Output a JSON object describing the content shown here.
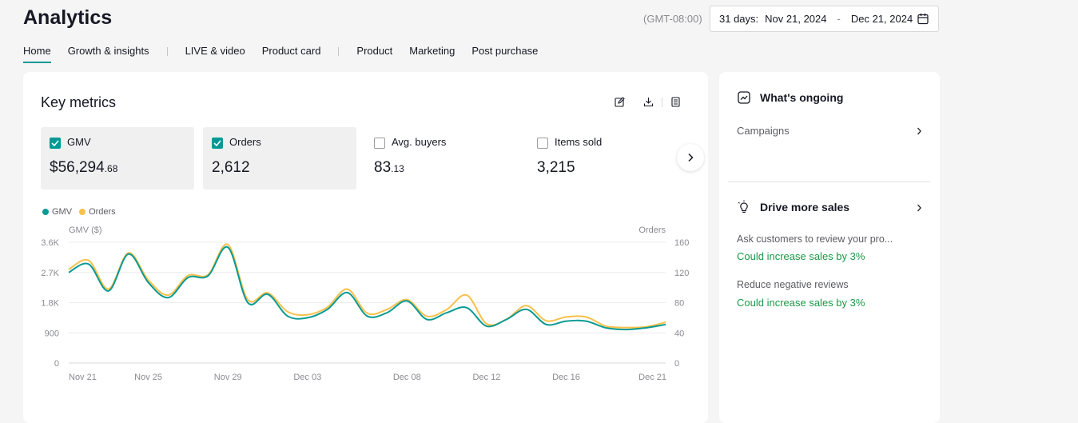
{
  "header": {
    "title": "Analytics",
    "timezone": "(GMT-08:00)",
    "date_range": {
      "prefix": "31 days:",
      "start": "Nov 21, 2024",
      "separator": "-",
      "end": "Dec 21, 2024"
    }
  },
  "tabs": [
    {
      "label": "Home",
      "active": true
    },
    {
      "label": "Growth & insights"
    },
    {
      "label": "LIVE & video"
    },
    {
      "label": "Product card"
    },
    {
      "label": "Product"
    },
    {
      "label": "Marketing"
    },
    {
      "label": "Post purchase"
    }
  ],
  "key_metrics": {
    "title": "Key metrics",
    "metrics": [
      {
        "label": "GMV",
        "checked": true,
        "prefix": "$",
        "value": "56,294",
        "decimal": ".68"
      },
      {
        "label": "Orders",
        "checked": true,
        "prefix": "",
        "value": "2,612",
        "decimal": ""
      },
      {
        "label": "Avg. buyers",
        "checked": false,
        "prefix": "",
        "value": "83",
        "decimal": ".13"
      },
      {
        "label": "Items sold",
        "checked": false,
        "prefix": "",
        "value": "3,215",
        "decimal": ""
      }
    ]
  },
  "colors": {
    "gmv": "#0a9a93",
    "orders": "#f7c14b",
    "accent": "#009995",
    "positive": "#1a9a47"
  },
  "chart_data": {
    "type": "line",
    "legend": [
      "GMV",
      "Orders"
    ],
    "legend_position": "top-left",
    "ylabel_left": "GMV ($)",
    "ylabel_right": "Orders",
    "x_ticks": [
      "Nov 21",
      "Nov 25",
      "Nov 29",
      "Dec 03",
      "Dec 08",
      "Dec 12",
      "Dec 16",
      "Dec 21"
    ],
    "y_left_ticks": [
      "0",
      "900",
      "1.8K",
      "2.7K",
      "3.6K"
    ],
    "y_right_ticks": [
      "0",
      "40",
      "80",
      "120",
      "160"
    ],
    "ylim_left": [
      0,
      3600
    ],
    "ylim_right": [
      0,
      160
    ],
    "grid": true,
    "x": [
      "Nov 21",
      "Nov 22",
      "Nov 23",
      "Nov 24",
      "Nov 25",
      "Nov 26",
      "Nov 27",
      "Nov 28",
      "Nov 29",
      "Nov 30",
      "Dec 01",
      "Dec 02",
      "Dec 03",
      "Dec 04",
      "Dec 05",
      "Dec 06",
      "Dec 07",
      "Dec 08",
      "Dec 09",
      "Dec 10",
      "Dec 11",
      "Dec 12",
      "Dec 13",
      "Dec 14",
      "Dec 15",
      "Dec 16",
      "Dec 17",
      "Dec 18",
      "Dec 19",
      "Dec 20",
      "Dec 21"
    ],
    "series": [
      {
        "name": "GMV",
        "axis": "left",
        "values": [
          2700,
          2950,
          2150,
          3250,
          2400,
          1950,
          2550,
          2600,
          3450,
          1800,
          2050,
          1400,
          1350,
          1600,
          2100,
          1400,
          1500,
          1850,
          1300,
          1500,
          1650,
          1100,
          1300,
          1600,
          1150,
          1250,
          1250,
          1050,
          1000,
          1050,
          1150
        ]
      },
      {
        "name": "Orders",
        "axis": "right",
        "values": [
          124,
          136,
          98,
          146,
          110,
          90,
          116,
          117,
          157,
          84,
          93,
          68,
          64,
          74,
          98,
          66,
          71,
          84,
          62,
          71,
          90,
          52,
          58,
          76,
          56,
          61,
          61,
          49,
          47,
          48,
          54
        ]
      }
    ]
  },
  "side": {
    "ongoing": {
      "title": "What's ongoing",
      "items": [
        "Campaigns"
      ]
    },
    "drive": {
      "title": "Drive more sales",
      "tips": [
        {
          "title": "Ask customers to review your pro...",
          "impact": "Could increase sales by 3%"
        },
        {
          "title": "Reduce negative reviews",
          "impact": "Could increase sales by 3%"
        }
      ]
    }
  }
}
